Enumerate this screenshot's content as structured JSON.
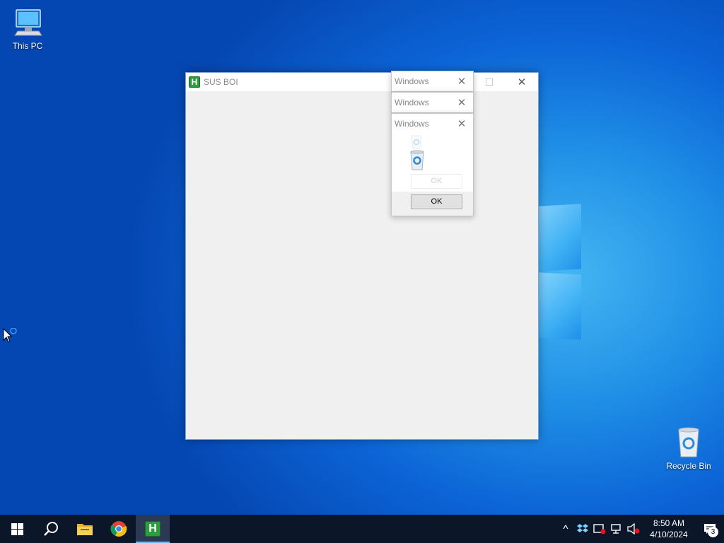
{
  "desktop": {
    "icons": [
      {
        "label": "This PC",
        "icon": "computer-icon"
      },
      {
        "label": "Recycle Bin",
        "icon": "recycle-bin-icon"
      }
    ]
  },
  "main_window": {
    "title": "SUS BOI",
    "app_icon_letter": "H",
    "maximize_glyph": "☐",
    "close_glyph": "✕"
  },
  "message_boxes": [
    {
      "title": "Windows",
      "close_glyph": "✕"
    },
    {
      "title": "Windows",
      "close_glyph": "✕"
    },
    {
      "title": "Windows",
      "close_glyph": "✕",
      "ok_label_faded": "OK",
      "ok_label": "OK"
    }
  ],
  "taskbar": {
    "pinned": [
      {
        "name": "start",
        "icon": "windows-start-icon"
      },
      {
        "name": "search",
        "icon": "search-icon"
      },
      {
        "name": "file-explorer",
        "icon": "folder-icon"
      },
      {
        "name": "chrome",
        "icon": "chrome-icon"
      },
      {
        "name": "sus-boi-app",
        "icon": "h-app-icon",
        "letter": "H",
        "active": true
      }
    ],
    "tray": {
      "chevron": "^",
      "time": "8:50 AM",
      "date": "4/10/2024",
      "notification_count": "3"
    }
  },
  "colors": {
    "taskbar_bg": "#0b1628",
    "app_green": "#2e9d3f",
    "accent_blue": "#76b9ed"
  }
}
